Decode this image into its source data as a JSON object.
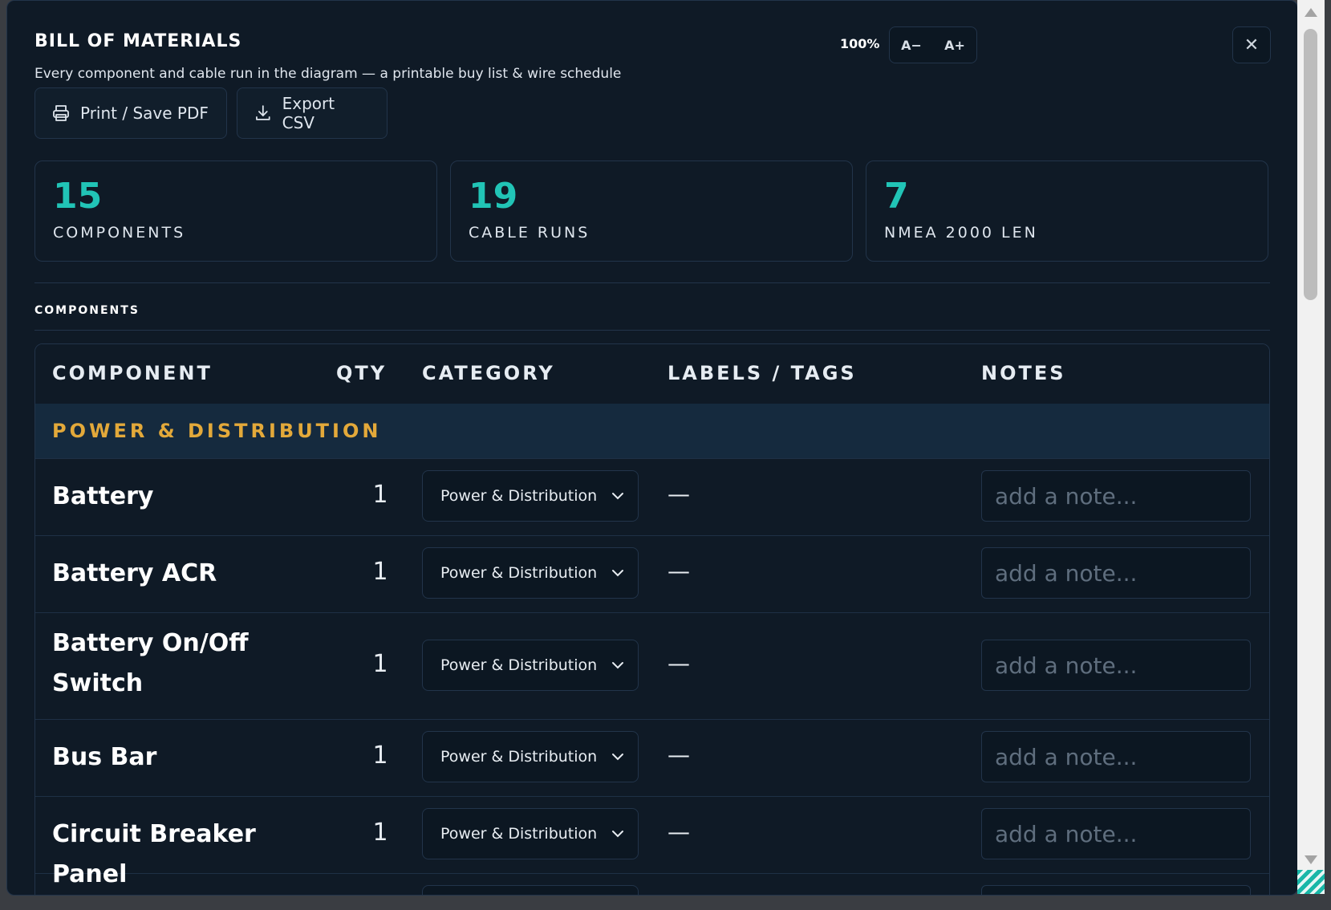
{
  "header": {
    "title": "BILL OF MATERIALS",
    "subtitle": "Every component and cable run in the diagram — a printable buy list & wire schedule",
    "zoom": "100%",
    "font_decrease": "A−",
    "font_increase": "A+",
    "close": "✕"
  },
  "toolbar": {
    "print_label": "Print / Save PDF",
    "csv_label": "Export CSV"
  },
  "stats": [
    {
      "value": "15",
      "label": "COMPONENTS"
    },
    {
      "value": "19",
      "label": "CABLE RUNS"
    },
    {
      "value": "7",
      "label": "NMEA 2000 LEN"
    }
  ],
  "section": {
    "title": "COMPONENTS"
  },
  "table": {
    "columns": [
      "COMPONENT",
      "QTY",
      "CATEGORY",
      "LABELS / TAGS",
      "NOTES"
    ],
    "group": "POWER & DISTRIBUTION",
    "rows": [
      {
        "name": "Battery",
        "qty": "1",
        "category": "Power & Distribution",
        "tags": "—",
        "note_placeholder": "add a note..."
      },
      {
        "name": "Battery ACR",
        "qty": "1",
        "category": "Power & Distribution",
        "tags": "—",
        "note_placeholder": "add a note..."
      },
      {
        "name": "Battery On/Off Switch",
        "qty": "1",
        "category": "Power & Distribution",
        "tags": "—",
        "note_placeholder": "add a note..."
      },
      {
        "name": "Bus Bar",
        "qty": "1",
        "category": "Power & Distribution",
        "tags": "—",
        "note_placeholder": "add a note..."
      },
      {
        "name": "Circuit Breaker Panel",
        "qty": "1",
        "category": "Power & Distribution",
        "tags": "—",
        "note_placeholder": "add a note..."
      }
    ]
  },
  "colors": {
    "accent": "#21c4b6",
    "group": "#e3a93a",
    "background": "#0f1a26"
  }
}
